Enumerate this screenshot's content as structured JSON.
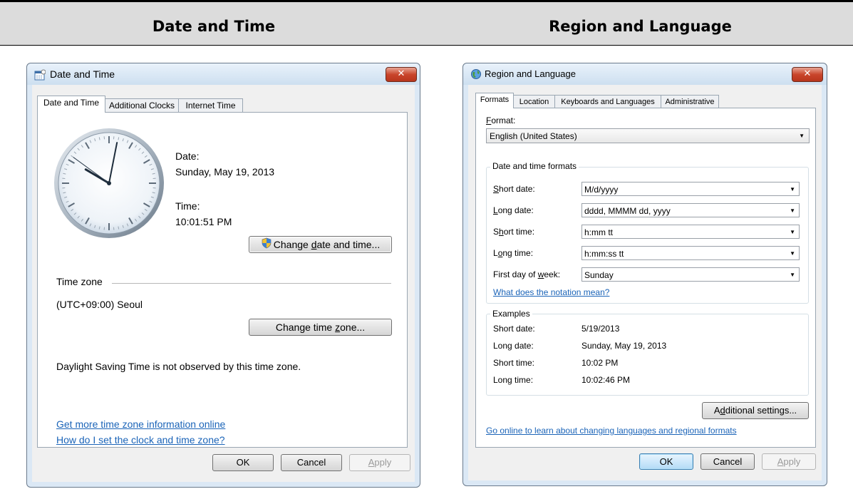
{
  "header": {
    "left": "Date and Time",
    "right": "Region and Language"
  },
  "date_time_window": {
    "title": "Date and Time",
    "close_glyph": "✕",
    "tabs": [
      "Date and Time",
      "Additional Clocks",
      "Internet Time"
    ],
    "date_label": "Date:",
    "date_value": "Sunday, May 19, 2013",
    "time_label": "Time:",
    "time_value": "10:01:51 PM",
    "change_datetime_btn": {
      "pre": "Change ",
      "u": "d",
      "post": "ate and time..."
    },
    "timezone_group_label": "Time zone",
    "timezone_value": "(UTC+09:00) Seoul",
    "change_timezone_btn": {
      "pre": "Change time ",
      "u": "z",
      "post": "one..."
    },
    "dst_note": "Daylight Saving Time is not observed by this time zone.",
    "link_more_info": "Get more time zone information online",
    "link_how_to": "How do I set the clock and time zone?",
    "ok": "OK",
    "cancel": "Cancel",
    "apply": {
      "u": "A",
      "post": "pply"
    },
    "clock": {
      "hour": 10,
      "minute": 1,
      "second": 51
    }
  },
  "region_window": {
    "title": "Region and Language",
    "close_glyph": "✕",
    "tabs": [
      "Formats",
      "Location",
      "Keyboards and Languages",
      "Administrative"
    ],
    "format_label": {
      "u": "F",
      "post": "ormat:"
    },
    "format_value": "English (United States)",
    "dt_group_label": "Date and time formats",
    "short_date": {
      "label_u": "S",
      "label_post": "hort date:",
      "value": "M/d/yyyy"
    },
    "long_date": {
      "label_u": "L",
      "label_post": "ong date:",
      "value": "dddd, MMMM dd, yyyy"
    },
    "short_time": {
      "label_pre": "S",
      "label_u": "h",
      "label_post": "ort time:",
      "value": "h:mm tt"
    },
    "long_time": {
      "label_pre": "L",
      "label_u": "o",
      "label_post": "ng time:",
      "value": "h:mm:ss tt"
    },
    "first_day": {
      "label_pre": "First day of ",
      "label_u": "w",
      "label_post": "eek:",
      "value": "Sunday"
    },
    "notation_link": "What does the notation mean?",
    "examples_label": "Examples",
    "examples": [
      {
        "label": "Short date:",
        "value": "5/19/2013"
      },
      {
        "label": "Long date:",
        "value": "Sunday, May 19, 2013"
      },
      {
        "label": "Short time:",
        "value": "10:02 PM"
      },
      {
        "label": "Long time:",
        "value": "10:02:46 PM"
      }
    ],
    "additional_btn": {
      "pre": "A",
      "u": "d",
      "post": "ditional settings..."
    },
    "online_link": "Go online to learn about changing languages and regional formats",
    "ok": "OK",
    "cancel": "Cancel",
    "apply": {
      "u": "A",
      "post": "pply"
    }
  }
}
